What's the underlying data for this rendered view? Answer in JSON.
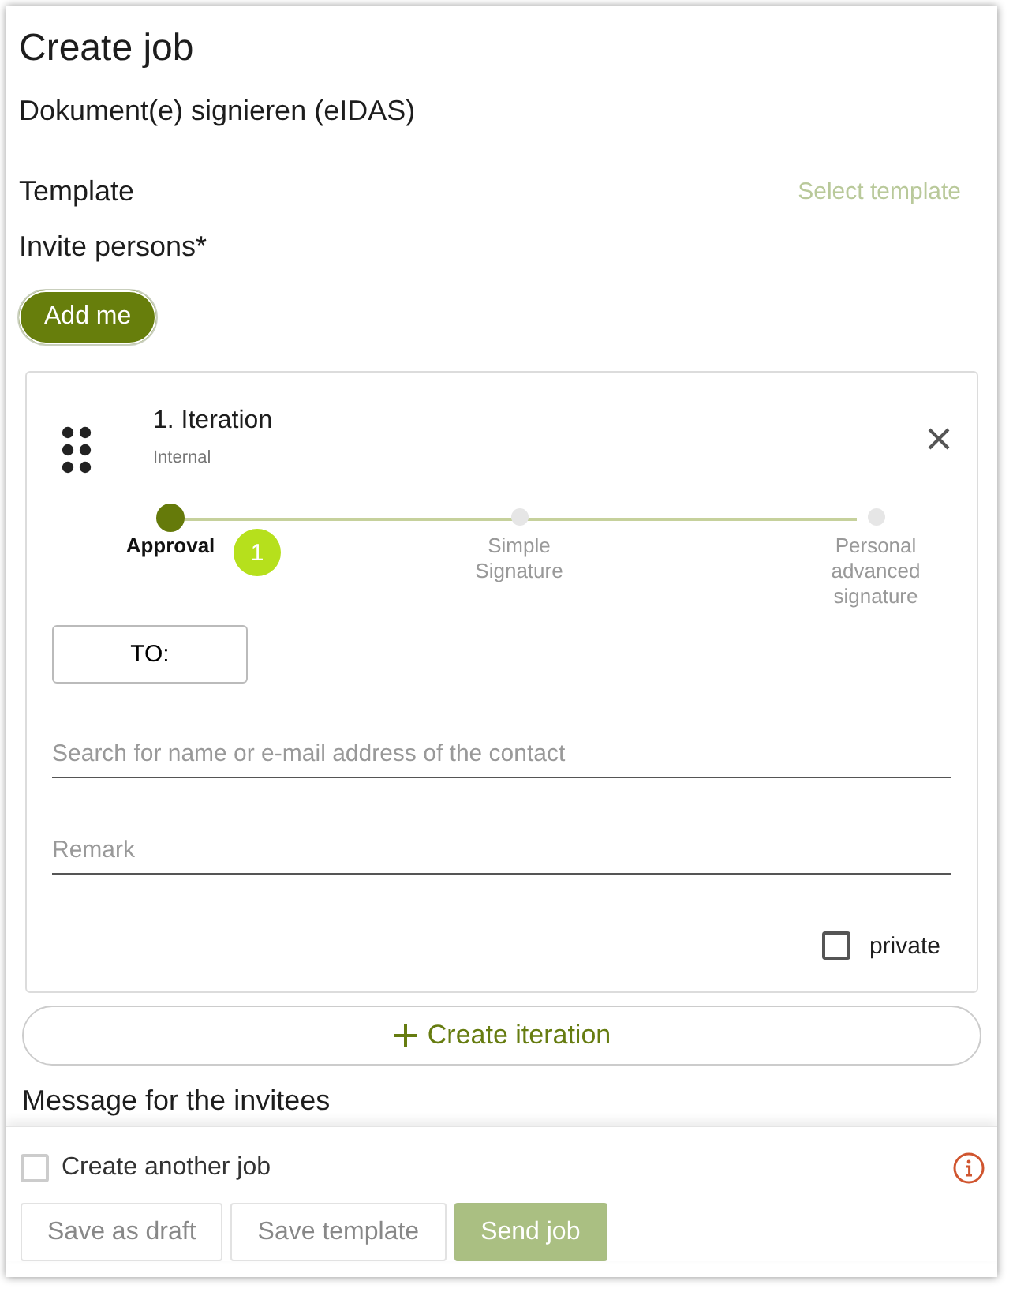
{
  "title": "Create job",
  "subtitle": "Dokument(e) signieren (eIDAS)",
  "template": {
    "label": "Template",
    "action": "Select template"
  },
  "invite": {
    "label": "Invite persons*",
    "add_button": "Add me"
  },
  "iteration": {
    "title": "1. Iteration",
    "subtitle": "Internal",
    "steps": [
      {
        "label": "Approval",
        "selected": true,
        "badge": "1"
      },
      {
        "label": "Simple Signature",
        "selected": false
      },
      {
        "label": "Personal advanced signature",
        "selected": false
      }
    ],
    "to_button": "TO:",
    "search": {
      "placeholder": "Search for name or e-mail address of the contact"
    },
    "remark": {
      "placeholder": "Remark"
    },
    "private": {
      "label": "private",
      "checked": false
    }
  },
  "create_iteration": "Create iteration",
  "message_heading": "Message for the invitees",
  "footer": {
    "another_job": {
      "label": "Create another job",
      "checked": false
    },
    "buttons": [
      {
        "label": "Save as draft",
        "kind": "secondary"
      },
      {
        "label": "Save template",
        "kind": "secondary"
      },
      {
        "label": "Send job",
        "kind": "primary"
      }
    ]
  }
}
